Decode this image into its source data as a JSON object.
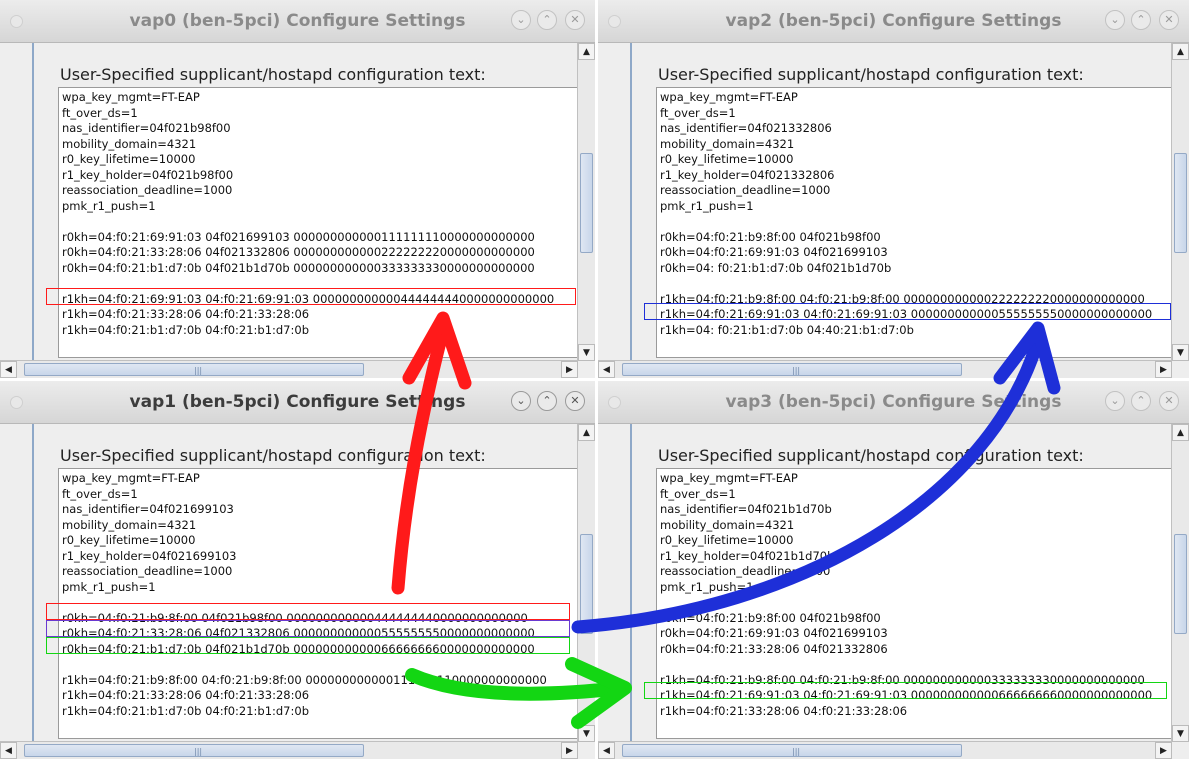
{
  "label": "User-Specified supplicant/hostapd configuration text:",
  "colors": {
    "red": "#ff1a1a",
    "blue": "#1e2fd8",
    "green": "#13d613",
    "purple": "#6a3ad0"
  },
  "windows": [
    {
      "title": "vap0  (ben-5pci) Configure Settings",
      "lines": [
        "wpa_key_mgmt=FT-EAP",
        "ft_over_ds=1",
        "nas_identifier=04f021b98f00",
        "mobility_domain=4321",
        "r0_key_lifetime=10000",
        "r1_key_holder=04f021b98f00",
        "reassociation_deadline=1000",
        "pmk_r1_push=1",
        "",
        "r0kh=04:f0:21:69:91:03 04f021699103 000000000000111111110000000000000",
        "r0kh=04:f0:21:33:28:06 04f021332806 000000000000222222220000000000000",
        "r0kh=04:f0:21:b1:d7:0b 04f021b1d70b 000000000000333333330000000000000",
        "",
        "r1kh=04:f0:21:69:91:03 04:f0:21:69:91:03 000000000000444444440000000000000",
        "r1kh=04:f0:21:33:28:06 04:f0:21:33:28:06",
        "r1kh=04:f0:21:b1:d7:0b 04:f0:21:b1:d7:0b"
      ]
    },
    {
      "title": "vap2  (ben-5pci) Configure Settings",
      "lines": [
        "wpa_key_mgmt=FT-EAP",
        "ft_over_ds=1",
        "nas_identifier=04f021332806",
        "mobility_domain=4321",
        "r0_key_lifetime=10000",
        "r1_key_holder=04f021332806",
        "reassociation_deadline=1000",
        "pmk_r1_push=1",
        "",
        "r0kh=04:f0:21:b9:8f:00 04f021b98f00",
        "r0kh=04:f0:21:69:91:03 04f021699103",
        "r0kh=04: f0:21:b1:d7:0b 04f021b1d70b",
        "",
        "r1kh=04:f0:21:b9:8f:00 04:f0:21:b9:8f:00 000000000000222222220000000000000",
        "r1kh=04:f0:21:69:91:03 04:f0:21:69:91:03 000000000000555555550000000000000",
        "r1kh=04: f0:21:b1:d7:0b 04:40:21:b1:d7:0b"
      ]
    },
    {
      "title": "vap1  (ben-5pci) Configure Settings",
      "lines": [
        "wpa_key_mgmt=FT-EAP",
        "ft_over_ds=1",
        "nas_identifier=04f021699103",
        "mobility_domain=4321",
        "r0_key_lifetime=10000",
        "r1_key_holder=04f021699103",
        "reassociation_deadline=1000",
        "pmk_r1_push=1",
        "",
        "r0kh=04:f0:21:b9:8f:00 04f021b98f00 000000000000444444440000000000000",
        "r0kh=04:f0:21:33:28:06 04f021332806 000000000000555555550000000000000",
        "r0kh=04:f0:21:b1:d7:0b 04f021b1d70b 000000000000666666660000000000000",
        "",
        "r1kh=04:f0:21:b9:8f:00 04:f0:21:b9:8f:00 000000000000111111110000000000000",
        "r1kh=04:f0:21:33:28:06 04:f0:21:33:28:06",
        "r1kh=04:f0:21:b1:d7:0b 04:f0:21:b1:d7:0b"
      ]
    },
    {
      "title": "vap3  (ben-5pci) Configure Settings",
      "lines": [
        "wpa_key_mgmt=FT-EAP",
        "ft_over_ds=1",
        "nas_identifier=04f021b1d70b",
        "mobility_domain=4321",
        "r0_key_lifetime=10000",
        "r1_key_holder=04f021b1d70b",
        "reassociation_deadline=1000",
        "pmk_r1_push=1",
        "",
        "r0kh=04:f0:21:b9:8f:00 04f021b98f00",
        "r0kh=04:f0:21:69:91:03 04f021699103",
        "r0kh=04:f0:21:33:28:06 04f021332806",
        "",
        "r1kh=04:f0:21:b9:8f:00 04:f0:21:b9:8f:00 000000000000333333330000000000000",
        "r1kh=04:f0:21:69:91:03 04:f0:21:69:91:03 000000000000666666660000000000000",
        "r1kh=04:f0:21:33:28:06 04:f0:21:33:28:06"
      ]
    }
  ]
}
